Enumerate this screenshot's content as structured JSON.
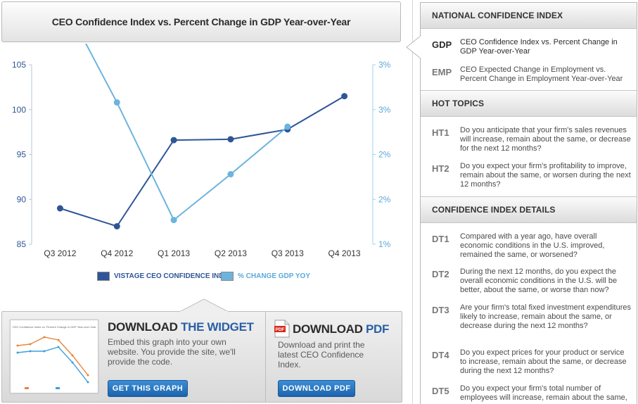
{
  "chart_title": "CEO Confidence Index vs. Percent Change in GDP Year-over-Year",
  "colors": {
    "ceo_series": "#2f5597",
    "gdp_series": "#6cb4de",
    "button": "#1d63ad",
    "accent": "#2a5fa4",
    "right_axis": "#5aa9da"
  },
  "chart_data": {
    "type": "line",
    "title": "CEO Confidence Index vs. Percent Change in GDP Year-over-Year",
    "categories": [
      "Q3 2012",
      "Q4 2012",
      "Q1 2013",
      "Q2 2013",
      "Q3 2013",
      "Q4 2013"
    ],
    "left_axis": {
      "ticks": [
        "105",
        "100",
        "95",
        "90",
        "85"
      ],
      "ylim": [
        85,
        105
      ]
    },
    "right_axis": {
      "ticks": [
        "3%",
        "3%",
        "2%",
        "2%",
        "1%"
      ],
      "ylim": [
        1.0,
        3.0
      ]
    },
    "series": [
      {
        "name": "VISTAGE CEO CONFIDENCE INDEX",
        "axis": "left",
        "values": [
          89.0,
          87.0,
          96.6,
          96.7,
          97.8,
          101.5
        ]
      },
      {
        "name": "% CHANGE GDP YOY",
        "axis": "right",
        "values": [
          3.78,
          2.58,
          1.27,
          1.78,
          2.31,
          null
        ]
      }
    ],
    "grid": false,
    "legend": "bottom-center"
  },
  "download_widget": {
    "heading_plain": "DOWNLOAD ",
    "heading_accent": "THE WIDGET",
    "text": "Embed this graph into your own website. You provide the site, we'll provide the code.",
    "button": "GET THIS GRAPH"
  },
  "download_pdf": {
    "heading_plain": "DOWNLOAD ",
    "heading_accent": "PDF",
    "text": "Download and print the latest CEO Confidence Index.",
    "button": "DOWNLOAD PDF",
    "icon": "pdf-icon"
  },
  "sidebar": {
    "national": {
      "heading": "NATIONAL CONFIDENCE INDEX",
      "items": [
        {
          "code": "GDP",
          "text": "CEO Confidence Index vs. Percent Change in GDP Year-over-Year",
          "active": true
        },
        {
          "code": "EMP",
          "text": "CEO Expected Change in Employment vs. Percent Change in Employment Year-over-Year",
          "active": false
        }
      ]
    },
    "hot_topics": {
      "heading": "HOT TOPICS",
      "items": [
        {
          "code": "HT1",
          "text": "Do you anticipate that your firm's sales revenues will increase, remain about the same, or decrease for the next 12 months?"
        },
        {
          "code": "HT2",
          "text": "Do you expect your firm's profitability to improve, remain about the same, or worsen during the next 12 months?"
        }
      ]
    },
    "details": {
      "heading": "CONFIDENCE INDEX DETAILS",
      "items": [
        {
          "code": "DT1",
          "text": "Compared with a year ago, have overall economic conditions in the U.S. improved, remained the same, or worsened?"
        },
        {
          "code": "DT2",
          "text": "During the next 12 months, do you expect the overall economic conditions in the U.S. will be better, about the same, or worse than now?"
        },
        {
          "code": "DT3",
          "text": "Are your firm's total fixed investment expenditures likely to increase, remain about the same, or decrease during the next 12 months?"
        },
        {
          "code": "DT4",
          "text": "Do you expect prices for your product or service to increase, remain about the same, or decrease during the next 12 months?"
        },
        {
          "code": "DT5",
          "text": "Do you expect your firm's total number of employees will increase, remain about the same,"
        }
      ]
    }
  }
}
